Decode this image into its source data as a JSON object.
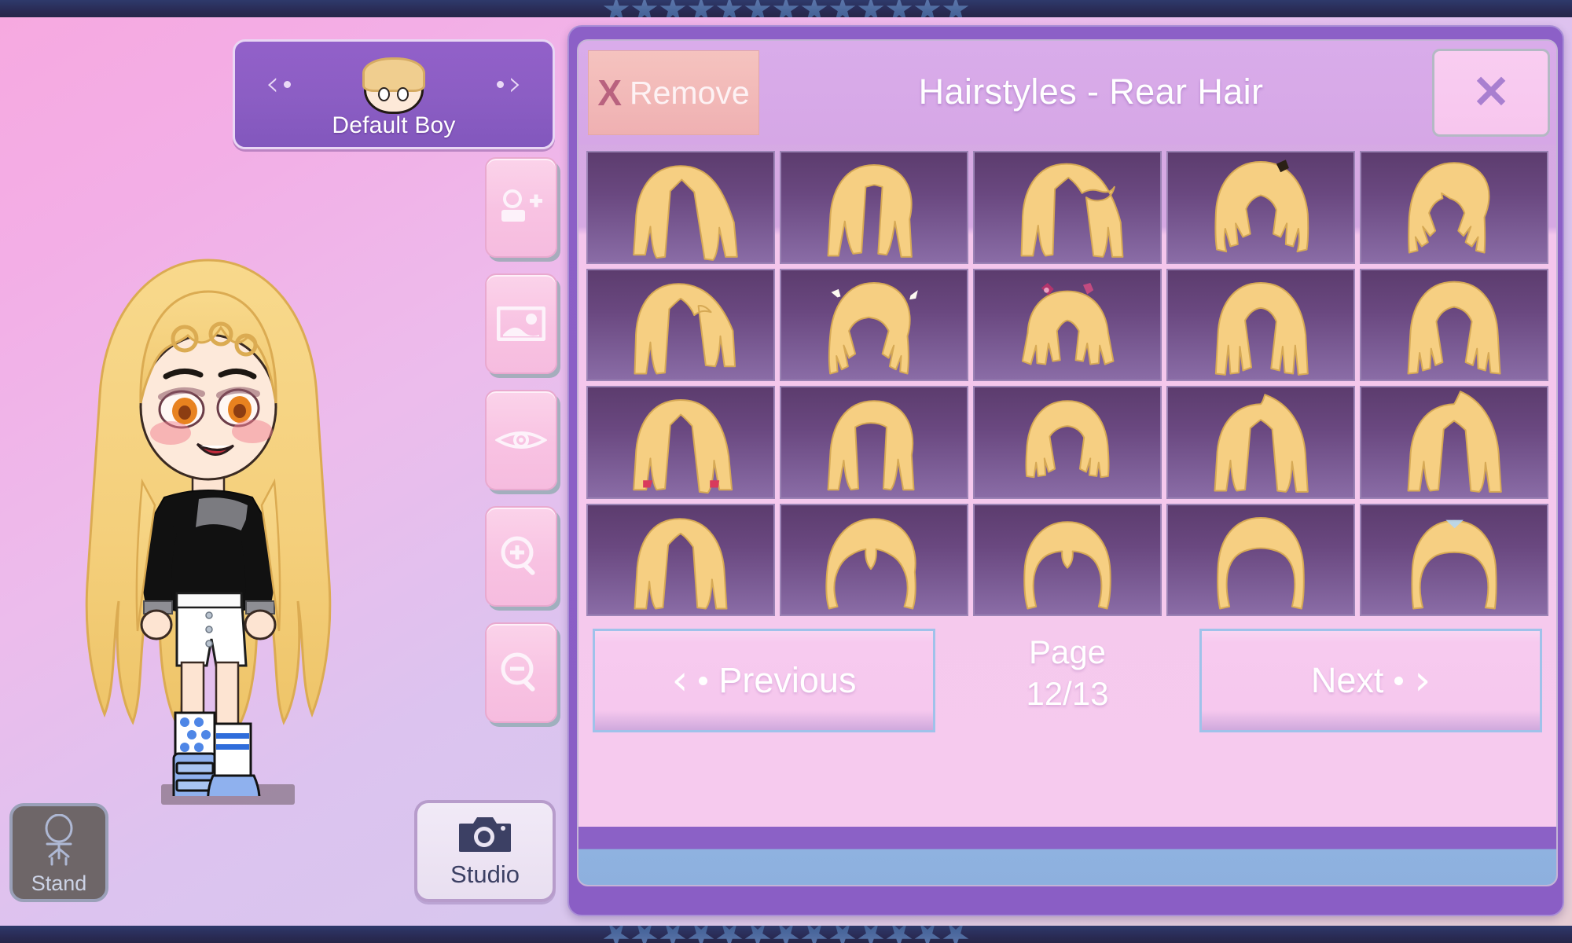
{
  "app": {
    "background_top": "#f6a9e0",
    "background_bottom": "#e6cdd4",
    "border_color": "#2a2c57",
    "star_color": "#4e6da3",
    "star_count": 13
  },
  "character_selector": {
    "prev_icon": "chevron-left-icon",
    "next_icon": "chevron-right-icon",
    "prev_glyph": "‹",
    "next_glyph": "›",
    "avatar_icon": "character-head-avatar",
    "name": "Default Boy"
  },
  "tools": {
    "items": [
      {
        "icon": "add-character-icon",
        "name": "add-character-button"
      },
      {
        "icon": "background-image-icon",
        "name": "background-button"
      },
      {
        "icon": "eye-preview-icon",
        "name": "preview-button"
      },
      {
        "icon": "zoom-in-icon",
        "name": "zoom-in-button"
      },
      {
        "icon": "zoom-out-icon",
        "name": "zoom-out-button"
      }
    ]
  },
  "stand_button": {
    "label": "Stand",
    "icon": "standing-figure-icon"
  },
  "studio_button": {
    "label": "Studio",
    "icon": "camera-icon"
  },
  "panel": {
    "remove_button": {
      "x_glyph": "X",
      "label": "Remove",
      "icon": "remove-x-icon"
    },
    "title": "Hairstyles - Rear Hair",
    "close_button": {
      "glyph": "✕",
      "icon": "close-x-icon"
    },
    "grid": {
      "columns": 5,
      "rows": 4,
      "items": [
        {
          "id": 1,
          "style": "long-straight-parted"
        },
        {
          "id": 2,
          "style": "long-straight-center-part"
        },
        {
          "id": 3,
          "style": "side-swept-long"
        },
        {
          "id": 4,
          "style": "short-spiky-layered"
        },
        {
          "id": 5,
          "style": "short-feathered-choppy"
        },
        {
          "id": 6,
          "style": "long-sleek-side-sweep"
        },
        {
          "id": 7,
          "style": "twin-braids-with-bows"
        },
        {
          "id": 8,
          "style": "spiky-pigtails-with-flowers"
        },
        {
          "id": 9,
          "style": "long-layered-sharp"
        },
        {
          "id": 10,
          "style": "wild-spiky-long"
        },
        {
          "id": 11,
          "style": "long-straight-with-red-ties"
        },
        {
          "id": 12,
          "style": "long-straight-blunt-fringe"
        },
        {
          "id": 13,
          "style": "short-bob-flip"
        },
        {
          "id": 14,
          "style": "long-straight-ahoge"
        },
        {
          "id": 15,
          "style": "long-straight-tall-ahoge"
        },
        {
          "id": 16,
          "style": "long-wavy-textured"
        },
        {
          "id": 17,
          "style": "voluminous-curls-parted"
        },
        {
          "id": 18,
          "style": "bouffant-waves"
        },
        {
          "id": 19,
          "style": "braided-updo-bun"
        },
        {
          "id": 20,
          "style": "long-crimped-with-clip"
        }
      ]
    },
    "pagination": {
      "previous_label": "Previous",
      "next_label": "Next",
      "prev_icon": "chevron-left-icon",
      "next_icon": "chevron-right-icon",
      "prev_glyph": "‹",
      "next_glyph": "›",
      "page_word": "Page",
      "page_value": "12/13",
      "current_page": 12,
      "total_pages": 13
    }
  }
}
